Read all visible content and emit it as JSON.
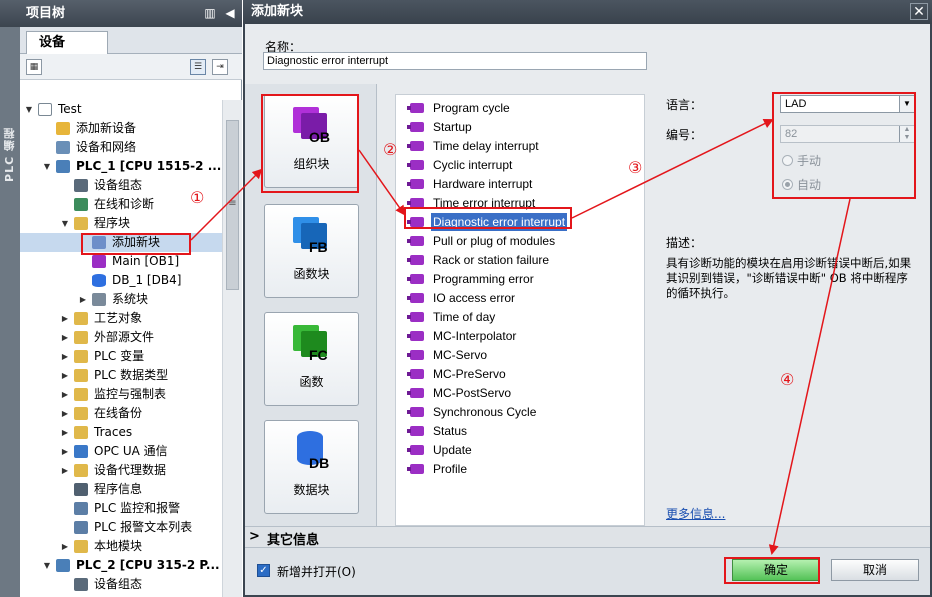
{
  "left": {
    "title": "项目树",
    "side_label": "PLC 编程",
    "tab": "设备",
    "tree": [
      {
        "label": "Test",
        "level": 0,
        "twisty": "▼",
        "icon": "doc"
      },
      {
        "label": "添加新设备",
        "level": 1,
        "twisty": "",
        "icon": "add"
      },
      {
        "label": "设备和网络",
        "level": 1,
        "twisty": "",
        "icon": "net"
      },
      {
        "label": "PLC_1 [CPU 1515-2 ...",
        "level": 1,
        "twisty": "▼",
        "icon": "plc",
        "bold": true
      },
      {
        "label": "设备组态",
        "level": 2,
        "twisty": "",
        "icon": "cfg"
      },
      {
        "label": "在线和诊断",
        "level": 2,
        "twisty": "",
        "icon": "diag"
      },
      {
        "label": "程序块",
        "level": 2,
        "twisty": "▼",
        "icon": "folder"
      },
      {
        "label": "添加新块",
        "level": 3,
        "twisty": "",
        "icon": "addblk",
        "selected": true
      },
      {
        "label": "Main [OB1]",
        "level": 3,
        "twisty": "",
        "icon": "ob"
      },
      {
        "label": "DB_1 [DB4]",
        "level": 3,
        "twisty": "",
        "icon": "db"
      },
      {
        "label": "系统块",
        "level": 3,
        "twisty": "▶",
        "icon": "sys"
      },
      {
        "label": "工艺对象",
        "level": 2,
        "twisty": "▶",
        "icon": "folder"
      },
      {
        "label": "外部源文件",
        "level": 2,
        "twisty": "▶",
        "icon": "folder"
      },
      {
        "label": "PLC 变量",
        "level": 2,
        "twisty": "▶",
        "icon": "folder"
      },
      {
        "label": "PLC 数据类型",
        "level": 2,
        "twisty": "▶",
        "icon": "folder"
      },
      {
        "label": "监控与强制表",
        "level": 2,
        "twisty": "▶",
        "icon": "folder"
      },
      {
        "label": "在线备份",
        "level": 2,
        "twisty": "▶",
        "icon": "folder"
      },
      {
        "label": "Traces",
        "level": 2,
        "twisty": "▶",
        "icon": "folder"
      },
      {
        "label": "OPC UA 通信",
        "level": 2,
        "twisty": "▶",
        "icon": "opc"
      },
      {
        "label": "设备代理数据",
        "level": 2,
        "twisty": "▶",
        "icon": "folder"
      },
      {
        "label": "程序信息",
        "level": 2,
        "twisty": "",
        "icon": "info"
      },
      {
        "label": "PLC 监控和报警",
        "level": 2,
        "twisty": "",
        "icon": "alarm"
      },
      {
        "label": "PLC 报警文本列表",
        "level": 2,
        "twisty": "",
        "icon": "alarm"
      },
      {
        "label": "本地模块",
        "level": 2,
        "twisty": "▶",
        "icon": "folder"
      },
      {
        "label": "PLC_2 [CPU 315-2 P...",
        "level": 1,
        "twisty": "▼",
        "icon": "plc",
        "bold": true
      },
      {
        "label": "设备组态",
        "level": 2,
        "twisty": "",
        "icon": "cfg"
      }
    ]
  },
  "dialog": {
    "title": "添加新块",
    "close_glyph": "✕",
    "name_label": "名称：",
    "name_value": "Diagnostic error interrupt",
    "block_types": [
      {
        "tag": "OB",
        "label": "组织块",
        "color": "#b030d8",
        "color2": "#7a1ca8"
      },
      {
        "tag": "FB",
        "label": "函数块",
        "color": "#2f8fe8",
        "color2": "#1766b8"
      },
      {
        "tag": "FC",
        "label": "函数",
        "color": "#38b838",
        "color2": "#1e8a1e"
      },
      {
        "tag": "DB",
        "label": "数据块",
        "color": "#2e6fe0",
        "color2": "#1a4fb0"
      }
    ],
    "ob_list": [
      "Program cycle",
      "Startup",
      "Time delay interrupt",
      "Cyclic interrupt",
      "Hardware interrupt",
      "Time error interrupt",
      "Diagnostic error interrupt",
      "Pull or plug of modules",
      "Rack or station failure",
      "Programming error",
      "IO access error",
      "Time of day",
      "MC-Interpolator",
      "MC-Servo",
      "MC-PreServo",
      "MC-PostServo",
      "Synchronous Cycle",
      "Status",
      "Update",
      "Profile"
    ],
    "selected_ob": "Diagnostic error interrupt",
    "language_label": "语言：",
    "language_value": "LAD",
    "number_label": "编号：",
    "number_value": "82",
    "radio_manual": "手动",
    "radio_auto": "自动",
    "desc_label": "描述：",
    "desc_text": "具有诊断功能的模块在启用诊断错误中断后,如果其识别到错误，\"诊断错误中断\" OB 将中断程序的循环执行。",
    "more_info": "更多信息...",
    "extra_info": "其它信息",
    "add_open_label": "新增并打开(O)",
    "ok_label": "确定",
    "cancel_label": "取消"
  },
  "annotations": {
    "step1": "①",
    "step2": "②",
    "step3": "③",
    "step4": "④",
    "color": "#e3161b"
  }
}
